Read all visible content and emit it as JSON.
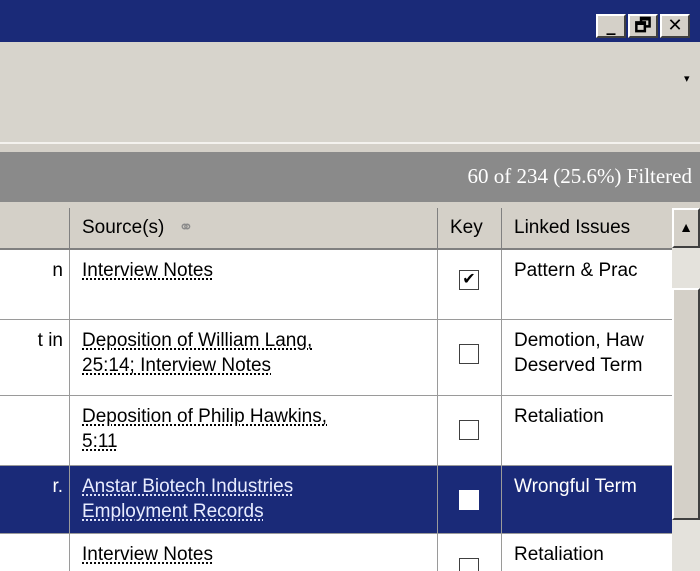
{
  "window": {
    "minimize_glyph": "_",
    "restore_glyph": "🗗",
    "close_glyph": "✕"
  },
  "toolbar": {
    "dropdown_arrow": "▾"
  },
  "filter": {
    "count_text": "60 of 234 (25.6%) Filtered"
  },
  "table": {
    "columns": [
      {
        "label": ""
      },
      {
        "label": "Source(s)",
        "icon": "link-icon"
      },
      {
        "label": "Key"
      },
      {
        "label": "Linked Issues"
      }
    ],
    "rows": [
      {
        "col0": "n",
        "source": [
          "Interview Notes"
        ],
        "key": true,
        "issues": "Pattern & Prac",
        "selected": false
      },
      {
        "col0": "t in",
        "source": [
          "Deposition of William Lang,",
          "25:14; Interview Notes"
        ],
        "key": false,
        "issues": "Demotion, Haw\nDeserved Term",
        "selected": false
      },
      {
        "col0": "",
        "source": [
          "Deposition of Philip Hawkins,",
          "5:11"
        ],
        "key": false,
        "issues": "Retaliation",
        "selected": false
      },
      {
        "col0": "r.",
        "source": [
          "Anstar Biotech Industries",
          "Employment Records"
        ],
        "key": false,
        "issues": "Wrongful Term",
        "selected": true
      },
      {
        "col0": "",
        "source": [
          "Interview Notes"
        ],
        "key": false,
        "issues": "Retaliation",
        "selected": false
      }
    ]
  },
  "scrollbar": {
    "up_arrow": "▲"
  },
  "colors": {
    "title_bar": "#1a2a78",
    "selected_row": "#1a2a78",
    "filter_bar": "#8a8a8a"
  }
}
